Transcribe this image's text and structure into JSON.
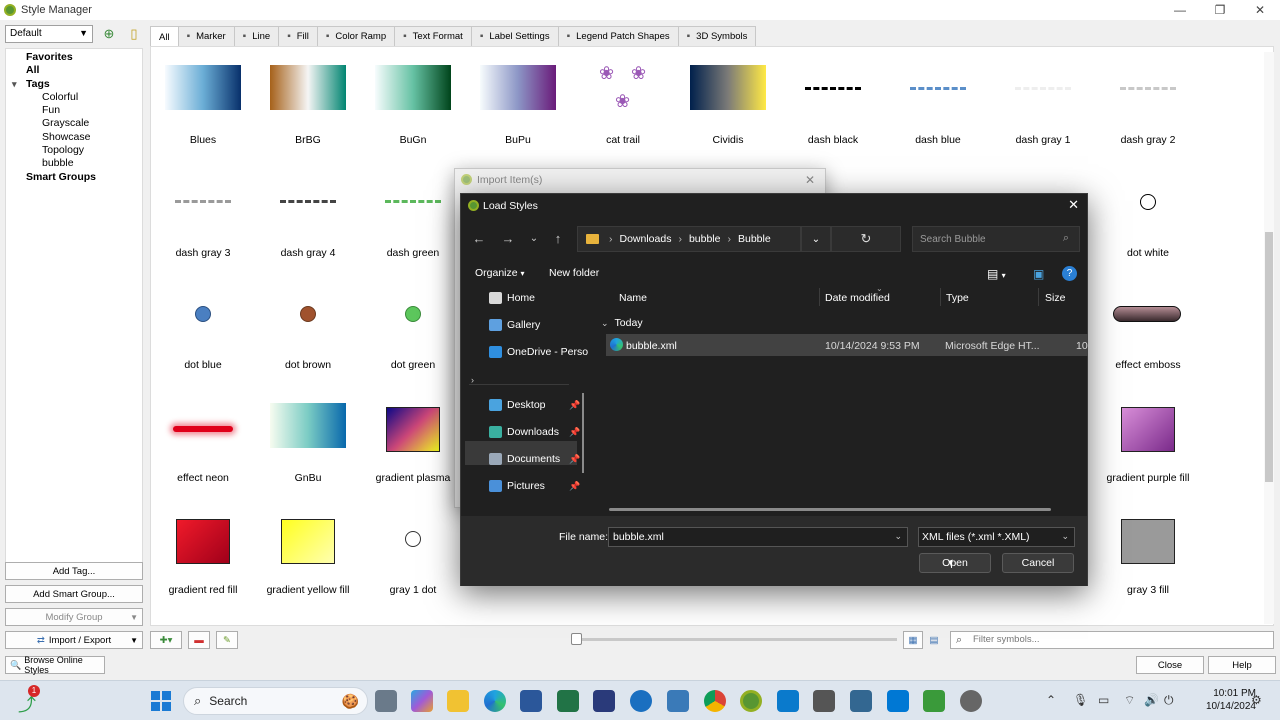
{
  "window": {
    "title": "Style Manager"
  },
  "left_panel": {
    "style_selector": "Default",
    "tree": [
      {
        "label": "Favorites",
        "bold": true,
        "indent": 0
      },
      {
        "label": "All",
        "bold": true,
        "indent": 0
      },
      {
        "label": "Tags",
        "bold": true,
        "indent": 0,
        "expanded": true
      },
      {
        "label": "Colorful",
        "bold": false,
        "indent": 1
      },
      {
        "label": "Fun",
        "bold": false,
        "indent": 1
      },
      {
        "label": "Grayscale",
        "bold": false,
        "indent": 1
      },
      {
        "label": "Showcase",
        "bold": false,
        "indent": 1
      },
      {
        "label": "Topology",
        "bold": false,
        "indent": 1
      },
      {
        "label": "bubble",
        "bold": false,
        "indent": 1
      },
      {
        "label": "Smart Groups",
        "bold": true,
        "indent": 0
      }
    ],
    "add_tag": "Add Tag...",
    "add_smart_group": "Add Smart Group...",
    "modify_group": "Modify Group",
    "import_export": "Import / Export",
    "browse_online": "Browse Online Styles"
  },
  "tabs": [
    {
      "label": "All",
      "icon": ""
    },
    {
      "label": "Marker",
      "icon": "marker-icon"
    },
    {
      "label": "Line",
      "icon": "line-icon"
    },
    {
      "label": "Fill",
      "icon": "fill-icon"
    },
    {
      "label": "Color Ramp",
      "icon": "color-ramp-icon"
    },
    {
      "label": "Text Format",
      "icon": "text-format-icon"
    },
    {
      "label": "Label Settings",
      "icon": "label-settings-icon"
    },
    {
      "label": "Legend Patch Shapes",
      "icon": "legend-patch-icon"
    },
    {
      "label": "3D Symbols",
      "icon": "3d-symbols-icon"
    }
  ],
  "symbols": [
    {
      "label": "Blues",
      "kind": "ramp",
      "colors": [
        "#f7fbff",
        "#6baed6",
        "#08306b"
      ]
    },
    {
      "label": "BrBG",
      "kind": "ramp",
      "colors": [
        "#a6611a",
        "#f5f5f5",
        "#018571"
      ]
    },
    {
      "label": "BuGn",
      "kind": "ramp",
      "colors": [
        "#f7fcfd",
        "#66c2a4",
        "#00441b"
      ]
    },
    {
      "label": "BuPu",
      "kind": "ramp",
      "colors": [
        "#f7fcfd",
        "#8c96c6",
        "#6a1b7a"
      ]
    },
    {
      "label": "cat trail",
      "kind": "paws",
      "colors": [
        "#9b59b6"
      ]
    },
    {
      "label": "Cividis",
      "kind": "ramp",
      "colors": [
        "#00204c",
        "#7c7b78",
        "#ffe945"
      ]
    },
    {
      "label": "dash  black",
      "kind": "dash",
      "colors": [
        "#000000"
      ]
    },
    {
      "label": "dash blue",
      "kind": "dash",
      "colors": [
        "#5b8fc9"
      ]
    },
    {
      "label": "dash gray 1",
      "kind": "dash",
      "colors": [
        "#eeeeee"
      ]
    },
    {
      "label": "dash gray 2",
      "kind": "dash",
      "colors": [
        "#c8c8c8"
      ]
    },
    {
      "label": "dash gray 3",
      "kind": "dash",
      "colors": [
        "#9a9a9a"
      ]
    },
    {
      "label": "dash gray 4",
      "kind": "dash",
      "colors": [
        "#444444"
      ]
    },
    {
      "label": "dash green",
      "kind": "dash",
      "colors": [
        "#5cb85c"
      ]
    },
    {
      "label": "",
      "kind": "hidden",
      "colors": []
    },
    {
      "label": "",
      "kind": "hidden",
      "colors": []
    },
    {
      "label": "",
      "kind": "hidden",
      "colors": []
    },
    {
      "label": "",
      "kind": "hidden",
      "colors": []
    },
    {
      "label": "",
      "kind": "hidden",
      "colors": []
    },
    {
      "label": "",
      "kind": "hidden",
      "colors": []
    },
    {
      "label": "dot  white",
      "kind": "dot",
      "colors": [
        "#ffffff",
        "#000000"
      ]
    },
    {
      "label": "dot blue",
      "kind": "dot",
      "colors": [
        "#4a7fc1",
        "#2a4f80"
      ]
    },
    {
      "label": "dot brown",
      "kind": "dot",
      "colors": [
        "#a0522d",
        "#6b3a1f"
      ]
    },
    {
      "label": "dot green",
      "kind": "dot",
      "colors": [
        "#5cc65c",
        "#3a8a3a"
      ]
    },
    {
      "label": "",
      "kind": "hidden",
      "colors": []
    },
    {
      "label": "",
      "kind": "hidden",
      "colors": []
    },
    {
      "label": "",
      "kind": "hidden",
      "colors": []
    },
    {
      "label": "",
      "kind": "hidden",
      "colors": []
    },
    {
      "label": "",
      "kind": "hidden",
      "colors": []
    },
    {
      "label": "",
      "kind": "hidden",
      "colors": []
    },
    {
      "label": "effect emboss",
      "kind": "pill",
      "colors": [
        "#b48c94",
        "#3a2a2e"
      ]
    },
    {
      "label": "effect neon",
      "kind": "neon",
      "colors": [
        "#e0001a"
      ]
    },
    {
      "label": "GnBu",
      "kind": "ramp",
      "colors": [
        "#f7fcf0",
        "#7bccc4",
        "#0868ac"
      ]
    },
    {
      "label": "gradient   plasma",
      "kind": "box",
      "colors": [
        "#0d0887",
        "#cc4778",
        "#f0f921"
      ]
    },
    {
      "label": "",
      "kind": "hidden",
      "colors": []
    },
    {
      "label": "",
      "kind": "hidden",
      "colors": []
    },
    {
      "label": "",
      "kind": "hidden",
      "colors": []
    },
    {
      "label": "",
      "kind": "hidden",
      "colors": []
    },
    {
      "label": "",
      "kind": "hidden",
      "colors": []
    },
    {
      "label": "",
      "kind": "hidden",
      "colors": []
    },
    {
      "label": "gradient purple fill",
      "kind": "box",
      "colors": [
        "#d98fd9",
        "#7a2a8a"
      ]
    },
    {
      "label": "gradient red fill",
      "kind": "box",
      "colors": [
        "#f01a2a",
        "#a0001a"
      ]
    },
    {
      "label": "gradient yellow fill",
      "kind": "box",
      "colors": [
        "#ffff20",
        "#ffffb0"
      ]
    },
    {
      "label": "gray 1 dot",
      "kind": "dot",
      "colors": [
        "#ffffff",
        "#333333"
      ]
    },
    {
      "label": "",
      "kind": "hidden",
      "colors": []
    },
    {
      "label": "",
      "kind": "hidden",
      "colors": []
    },
    {
      "label": "",
      "kind": "hidden",
      "colors": []
    },
    {
      "label": "",
      "kind": "hidden",
      "colors": []
    },
    {
      "label": "",
      "kind": "hidden",
      "colors": []
    },
    {
      "label": "",
      "kind": "hidden",
      "colors": []
    },
    {
      "label": "gray 3 fill",
      "kind": "box",
      "colors": [
        "#9a9a9a",
        "#9a9a9a"
      ]
    }
  ],
  "bottom_bar": {
    "filter_placeholder": "Filter symbols...",
    "close": "Close",
    "help": "Help"
  },
  "import_dialog": {
    "title": "Import Item(s)"
  },
  "load_dialog": {
    "title": "Load Styles",
    "breadcrumb": [
      "Downloads",
      "bubble",
      "Bubble"
    ],
    "search_placeholder": "Search Bubble",
    "organize": "Organize",
    "new_folder": "New folder",
    "nav": [
      {
        "label": "Home",
        "color": "#d9d9d9",
        "pinned": false
      },
      {
        "label": "Gallery",
        "color": "#5ea0e0",
        "pinned": false
      },
      {
        "label": "OneDrive - Perso",
        "color": "#2f8fe0",
        "pinned": false
      },
      {
        "label": "Desktop",
        "color": "#4aa3df",
        "pinned": true
      },
      {
        "label": "Downloads",
        "color": "#3ab0a0",
        "pinned": true
      },
      {
        "label": "Documents",
        "color": "#9aa8b8",
        "pinned": true
      },
      {
        "label": "Pictures",
        "color": "#4a90d9",
        "pinned": true
      }
    ],
    "columns": [
      "Name",
      "Date modified",
      "Type",
      "Size"
    ],
    "group": "Today",
    "file": {
      "name": "bubble.xml",
      "date": "10/14/2024 9:53 PM",
      "type": "Microsoft Edge HT...",
      "size": "10"
    },
    "file_name_label": "File name:",
    "file_name_value": "bubble.xml",
    "file_type": "XML files (*.xml *.XML)",
    "open": "Open",
    "cancel": "Cancel"
  },
  "taskbar": {
    "search": "Search",
    "notification_badge": "1",
    "time": "10:01 PM",
    "date": "10/14/2024"
  }
}
